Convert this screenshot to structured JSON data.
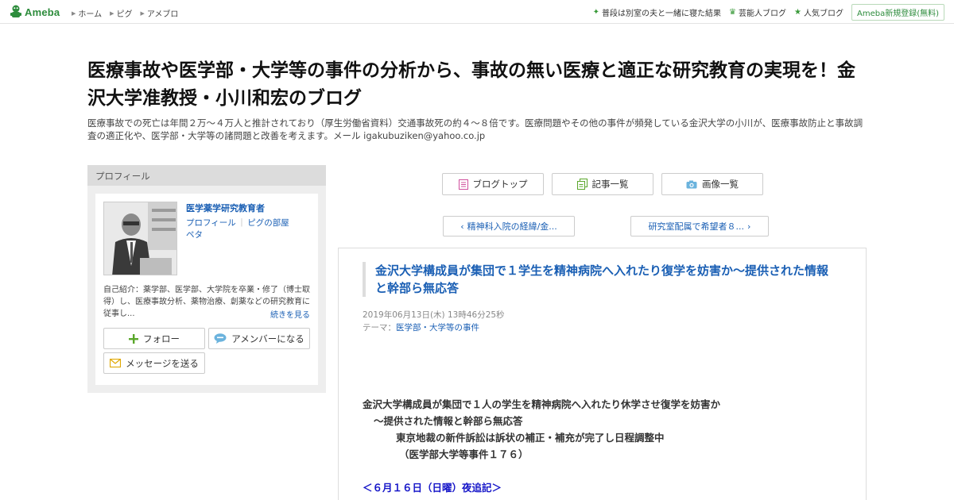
{
  "topbar": {
    "logo": "Ameba",
    "nav": [
      "ホーム",
      "ピグ",
      "アメブロ"
    ],
    "right_links": [
      "普段は別室の夫と一緒に寝た結果",
      "芸能人ブログ",
      "人気ブログ"
    ],
    "signup": "Ameba新規登録(無料)"
  },
  "header": {
    "title": "医療事故や医学部・大学等の事件の分析から、事故の無い医療と適正な研究教育の実現を！金沢大学准教授・小川和宏のブログ",
    "description": "医療事故での死亡は年間２万〜４万人と推計されており（厚生労働省資料）交通事故死の約４〜８倍です。医療問題やその他の事件が頻発している金沢大学の小川が、医療事故防止と事故調査の適正化や、医学部・大学等の諸問題と改善を考えます。メール igakubuziken@yahoo.co.jp"
  },
  "profile": {
    "heading": "プロフィール",
    "name": "医学薬学研究教育者",
    "link_profile": "プロフィール",
    "link_separator": "｜",
    "link_room": "ピグの部屋",
    "link_peta": "ペタ",
    "intro": "自己紹介：薬学部、医学部、大学院を卒業・修了（博士取得）し、医療事故分析、薬物治療、創薬などの研究教育に従事し...",
    "more": "続きを見る",
    "follow": "フォロー",
    "amember": "アメンバーになる",
    "message": "メッセージを送る"
  },
  "main": {
    "nav": {
      "top": "ブログトップ",
      "list": "記事一覧",
      "images": "画像一覧"
    },
    "prev": "精神科入院の経緯/金...",
    "next": "研究室配属で希望者８...",
    "entry": {
      "title": "金沢大学構成員が集団で１学生を精神病院へ入れたり復学を妨害か〜提供された情報と幹部ら無応答",
      "date": "2019年06月13日(木) 13時46分25秒",
      "theme_label": "テーマ：",
      "theme": "医学部・大学等の事件",
      "lines": [
        "金沢大学構成員が集団で１人の学生を精神病院へ入れたり休学させ復学を妨害か",
        "〜提供された情報と幹部ら無応答",
        "東京地裁の新件訴訟は訴状の補正・補充が完了し日程調整中",
        "（医学部大学等事件１７６）",
        "＜６月１６日（日曜）夜追記＞"
      ]
    }
  },
  "colors": {
    "brand_green": "#2d8c3c",
    "link_blue": "#1a5fb4",
    "note_blue": "#1414c8"
  }
}
